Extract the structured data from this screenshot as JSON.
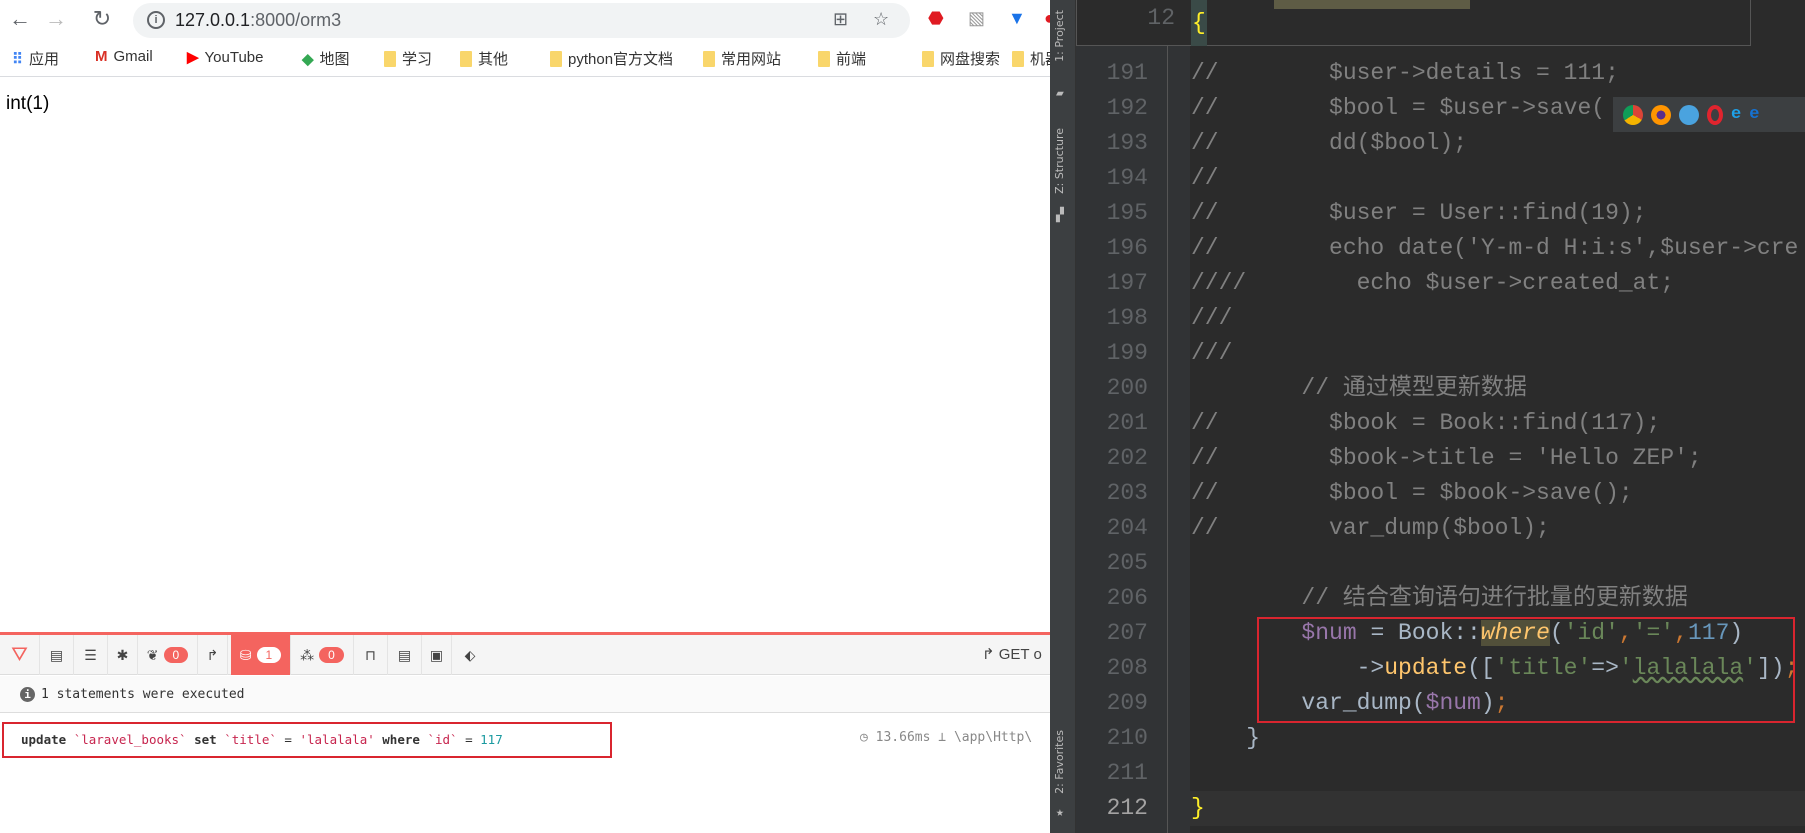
{
  "browser": {
    "url_host": "127.0.0.1",
    "url_path": ":8000/orm3",
    "bookmarks": [
      {
        "label": "应用",
        "icon": "apps-grid-icon"
      },
      {
        "label": "Gmail",
        "icon": "gmail-icon"
      },
      {
        "label": "YouTube",
        "icon": "youtube-icon"
      },
      {
        "label": "地图",
        "icon": "maps-icon"
      },
      {
        "label": "学习",
        "icon": "folder-icon"
      },
      {
        "label": "其他",
        "icon": "folder-icon"
      },
      {
        "label": "python官方文档",
        "icon": "folder-icon"
      },
      {
        "label": "常用网站",
        "icon": "folder-icon"
      },
      {
        "label": "前端",
        "icon": "folder-icon"
      },
      {
        "label": "网盘搜索",
        "icon": "folder-icon"
      },
      {
        "label": "机器",
        "icon": "folder-icon"
      }
    ],
    "page_output": "int(1)"
  },
  "debugbar": {
    "accent": "#f4645f",
    "badges": {
      "timeline": "0",
      "queries": "1",
      "models": "0"
    },
    "request": "GET o",
    "message": "1 statements were executed",
    "query": {
      "parts": [
        {
          "t": "update",
          "c": "kw"
        },
        {
          "t": " ",
          "c": "qo"
        },
        {
          "t": "`laravel_books`",
          "c": "qs"
        },
        {
          "t": " ",
          "c": "qo"
        },
        {
          "t": "set",
          "c": "kw"
        },
        {
          "t": " ",
          "c": "qo"
        },
        {
          "t": "`title`",
          "c": "qs"
        },
        {
          "t": " = ",
          "c": "qo"
        },
        {
          "t": "'lalalala'",
          "c": "qs"
        },
        {
          "t": " ",
          "c": "qo"
        },
        {
          "t": "where",
          "c": "kw"
        },
        {
          "t": " ",
          "c": "qo"
        },
        {
          "t": "`id`",
          "c": "qs"
        },
        {
          "t": " = ",
          "c": "qo"
        },
        {
          "t": "117",
          "c": "qn"
        }
      ],
      "duration": "13.66ms",
      "source": "\\app\\Http\\"
    }
  },
  "ide": {
    "side_tabs": {
      "project": "1: Project",
      "structure": "Z: Structure",
      "favorites": "2: Favorites"
    },
    "sticky_line": {
      "num": "12",
      "tokens": [
        {
          "t": "{",
          "c": "brace"
        }
      ]
    },
    "lines": [
      {
        "num": "191",
        "tokens": [
          {
            "t": "//        $user->details = 111;",
            "c": "com"
          }
        ]
      },
      {
        "num": "192",
        "tokens": [
          {
            "t": "//        $bool = $user->save(",
            "c": "com"
          }
        ]
      },
      {
        "num": "193",
        "tokens": [
          {
            "t": "//        dd($bool);",
            "c": "com"
          }
        ]
      },
      {
        "num": "194",
        "tokens": [
          {
            "t": "//",
            "c": "com"
          }
        ]
      },
      {
        "num": "195",
        "tokens": [
          {
            "t": "//        $user = User::find(19);",
            "c": "com"
          }
        ]
      },
      {
        "num": "196",
        "tokens": [
          {
            "t": "//        echo date('Y-m-d H:i:s',$user->cre",
            "c": "com"
          }
        ]
      },
      {
        "num": "197",
        "tokens": [
          {
            "t": "////        echo $user->created_at;",
            "c": "com"
          }
        ]
      },
      {
        "num": "198",
        "tokens": [
          {
            "t": "///",
            "c": "com"
          }
        ]
      },
      {
        "num": "199",
        "tokens": [
          {
            "t": "///",
            "c": "com"
          }
        ]
      },
      {
        "num": "200",
        "tokens": [
          {
            "t": "        // 通过模型更新数据",
            "c": "com"
          }
        ]
      },
      {
        "num": "201",
        "tokens": [
          {
            "t": "//        $book = Book::find(117);",
            "c": "com"
          }
        ]
      },
      {
        "num": "202",
        "tokens": [
          {
            "t": "//        $book->title = 'Hello ZEP';",
            "c": "com"
          }
        ]
      },
      {
        "num": "203",
        "tokens": [
          {
            "t": "//        $bool = $book->save();",
            "c": "com"
          }
        ]
      },
      {
        "num": "204",
        "tokens": [
          {
            "t": "//        var_dump($bool);",
            "c": "com"
          }
        ]
      },
      {
        "num": "205",
        "tokens": []
      },
      {
        "num": "206",
        "tokens": [
          {
            "t": "        // 结合查询语句进行批量的更新数据",
            "c": "com"
          }
        ]
      },
      {
        "num": "207",
        "tokens": [
          {
            "t": "        ",
            "c": "def"
          },
          {
            "t": "$num",
            "c": "var"
          },
          {
            "t": " = Book::",
            "c": "def"
          },
          {
            "t": "where",
            "c": "fn"
          },
          {
            "t": "(",
            "c": "def"
          },
          {
            "t": "'id'",
            "c": "str"
          },
          {
            "t": ",",
            "c": "semi"
          },
          {
            "t": "'='",
            "c": "str"
          },
          {
            "t": ",",
            "c": "semi"
          },
          {
            "t": "117",
            "c": "num"
          },
          {
            "t": ")",
            "c": "def"
          }
        ]
      },
      {
        "num": "208",
        "tokens": [
          {
            "t": "            ->",
            "c": "def"
          },
          {
            "t": "update",
            "c": "fn2"
          },
          {
            "t": "([",
            "c": "def"
          },
          {
            "t": "'title'",
            "c": "str"
          },
          {
            "t": "=>",
            "c": "def"
          },
          {
            "t": "'",
            "c": "str"
          },
          {
            "t": "lalalala",
            "c": "wavy"
          },
          {
            "t": "'",
            "c": "str"
          },
          {
            "t": "])",
            "c": "def"
          },
          {
            "t": ";",
            "c": "semi"
          }
        ]
      },
      {
        "num": "209",
        "tokens": [
          {
            "t": "        var_dump(",
            "c": "def"
          },
          {
            "t": "$num",
            "c": "var"
          },
          {
            "t": ")",
            "c": "def"
          },
          {
            "t": ";",
            "c": "semi"
          }
        ]
      },
      {
        "num": "210",
        "tokens": [
          {
            "t": "    }",
            "c": "def"
          }
        ]
      },
      {
        "num": "211",
        "tokens": []
      },
      {
        "num": "212",
        "tokens": [
          {
            "t": "}",
            "c": "brace"
          }
        ]
      }
    ]
  }
}
